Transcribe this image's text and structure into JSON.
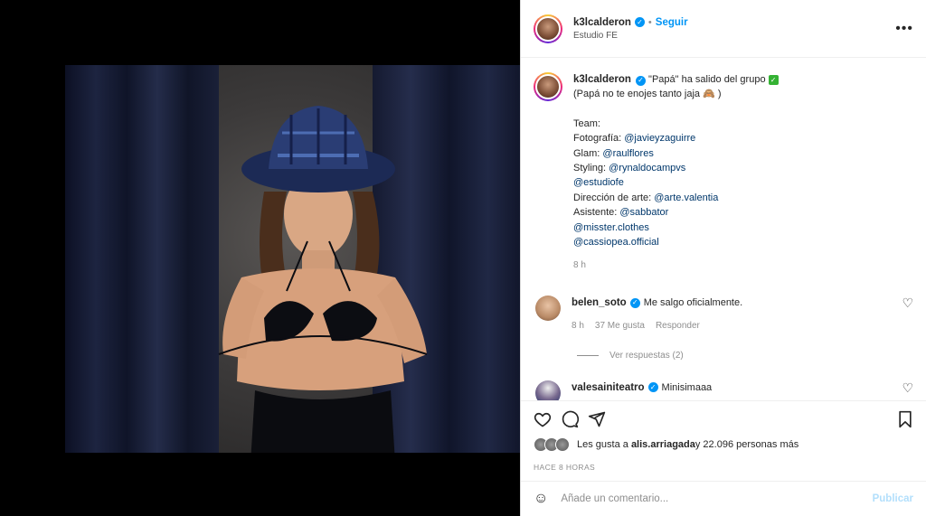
{
  "post": {
    "author": "k3lcalderon",
    "follow_label": "Seguir",
    "separator": "•",
    "location": "Estudio FE",
    "more": "•••"
  },
  "caption": {
    "headline": "\"Papá\" ha salido del grupo",
    "check": "✓",
    "line2": "(Papá no te enojes tanto jaja 🙈 )",
    "team_label": "Team:",
    "credits": [
      {
        "label": "Fotografía: ",
        "mention": "@javieyzaguirre"
      },
      {
        "label": "Glam: ",
        "mention": "@raulflores"
      },
      {
        "label": "Styling: ",
        "mention": "@rynaldocampvs"
      },
      {
        "label": "",
        "mention": "@estudiofe"
      },
      {
        "label": "Dirección de arte: ",
        "mention": "@arte.valentia"
      },
      {
        "label": "Asistente: ",
        "mention": "@sabbator"
      },
      {
        "label": "",
        "mention": "@misster.clothes"
      },
      {
        "label": "",
        "mention": "@cassiopea.official"
      }
    ],
    "time": "8 h"
  },
  "comments": [
    {
      "user": "belen_soto",
      "text": "Me salgo oficialmente.",
      "time": "8 h",
      "likes": "37 Me gusta",
      "reply": "Responder",
      "view_replies": "Ver respuestas (2)"
    },
    {
      "user": "valesainiteatro",
      "text": "Minisimaaa"
    }
  ],
  "likes_text": "Les gusta a ",
  "likes_user": "alis.arriagada",
  "likes_rest": " y 22.096 personas más",
  "time_ago": "HACE 8 HORAS",
  "add_comment": {
    "placeholder": "Añade un comentario...",
    "publish": "Publicar"
  },
  "icons": {
    "like": "heart-icon",
    "comment": "comment-icon",
    "share": "share-icon",
    "save": "bookmark-icon",
    "emoji": "emoji-icon"
  },
  "colors": {
    "accent": "#0095f6",
    "mention": "#00376b",
    "muted": "#8e8e8e",
    "publish_disabled": "#b2dffc"
  }
}
